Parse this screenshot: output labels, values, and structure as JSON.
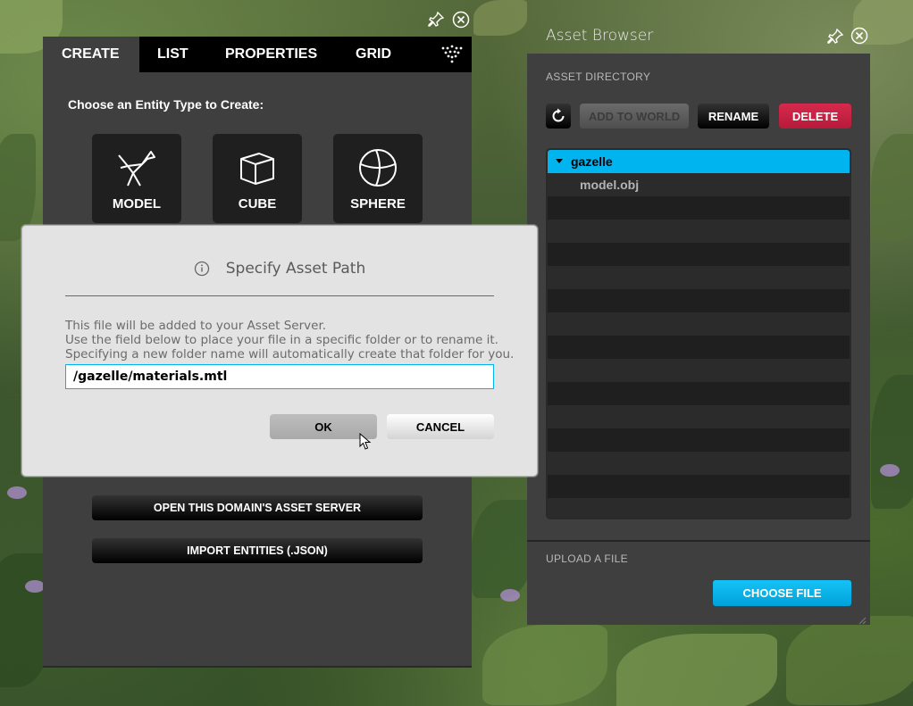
{
  "create_panel": {
    "tabs": [
      "CREATE",
      "LIST",
      "PROPERTIES",
      "GRID"
    ],
    "active_tab": "CREATE",
    "extra_tab_icon": "particles-icon",
    "choose_label": "Choose an Entity Type to Create:",
    "entities": [
      {
        "label": "MODEL",
        "icon": "bird-model-icon"
      },
      {
        "label": "CUBE",
        "icon": "cube-icon"
      },
      {
        "label": "SPHERE",
        "icon": "sphere-icon"
      }
    ],
    "open_asset_server_label": "OPEN THIS DOMAIN'S ASSET SERVER",
    "import_entities_label": "IMPORT ENTITIES (.JSON)"
  },
  "asset_browser": {
    "title": "Asset Browser",
    "directory_label": "ASSET DIRECTORY",
    "buttons": {
      "refresh": "refresh-icon",
      "add_to_world": "ADD TO WORLD",
      "rename": "RENAME",
      "delete": "DELETE"
    },
    "tree": {
      "folder": "gazelle",
      "files": [
        "model.obj"
      ]
    },
    "upload_label": "UPLOAD A FILE",
    "choose_file_label": "CHOOSE FILE"
  },
  "dialog": {
    "title": "Specify Asset Path",
    "info_icon": "info-icon",
    "lines": [
      "This file will be added to your Asset Server.",
      "Use the field below to place your file in a specific folder or to rename it.",
      "Specifying a new folder name will automatically create that folder for you."
    ],
    "input_value": "/gazelle/materials.mtl",
    "ok_label": "OK",
    "cancel_label": "CANCEL"
  },
  "colors": {
    "accent": "#00b4ef",
    "delete": "#c91f42",
    "panel": "#3f3f3f",
    "dialog": "#e3e3e3"
  }
}
